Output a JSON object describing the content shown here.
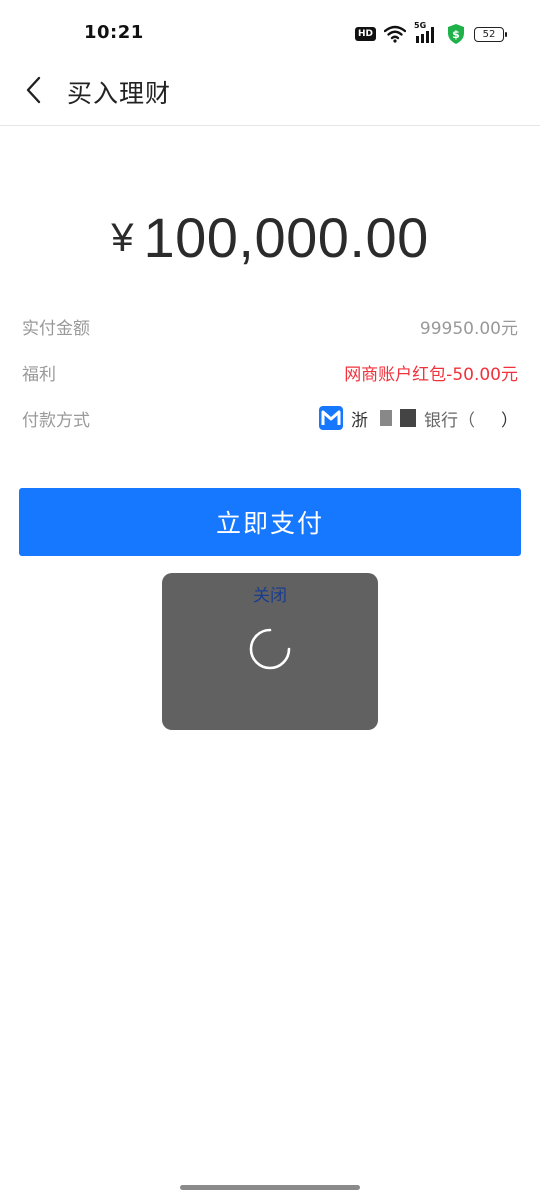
{
  "status_bar": {
    "time": "10:21",
    "hd": "HD",
    "network": "5G",
    "battery": "52"
  },
  "header": {
    "title": "买入理财"
  },
  "amount": {
    "symbol": "¥",
    "value": "100,000.00"
  },
  "details": {
    "actual_pay_label": "实付金额",
    "actual_pay_value": "99950.00元",
    "benefit_label": "福利",
    "benefit_value": "网商账户红包-50.00元",
    "pay_method_label": "付款方式",
    "pay_method_value_start": "浙",
    "pay_method_value_partial": "银行（",
    "pay_method_value_end": "）"
  },
  "actions": {
    "pay_button": "立即支付"
  },
  "loading": {
    "close_label": "关闭"
  },
  "colors": {
    "primary": "#1677ff",
    "benefit_red": "#f0323c",
    "toast_bg": "#616161",
    "close_link": "#1a3d8f"
  }
}
